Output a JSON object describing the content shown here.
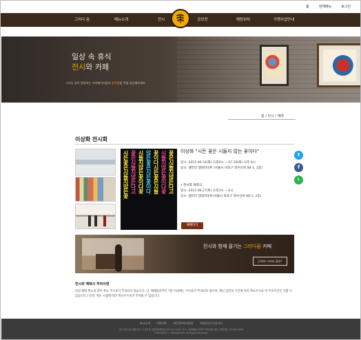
{
  "util": {
    "home": "홈",
    "login": "전체메뉴",
    "join": "로그인"
  },
  "nav": {
    "items": [
      "그리다 꿈",
      "메뉴소개",
      "전시",
      "공모전",
      "매장위치",
      "가맹사업안내"
    ]
  },
  "logo": {
    "name": "griddaggum-logo-icon",
    "color": "#f2a900"
  },
  "hero": {
    "line1": "일상 속 휴식",
    "line2_highlight": "전시",
    "line2_rest": "와 카페",
    "subtitle_prefix": "그리다 꿈이 응원하는 크리에이터들의 ",
    "subtitle_highlight": "창작품",
    "subtitle_suffix": "을 직접 감상해보세요"
  },
  "breadcrumb": "홈  /  전시  /  예매",
  "page_title": "이상화 전시회",
  "exhibit": {
    "title": "이상화 \"시든 꽃은 시들지 않는 꽃이다\"",
    "period": "일시: 2015.06.16(화) 오후6시 ~ 07.28(화) 오후 6시",
    "place": "장소: 갤러리 행원러미트 (서울시 마포구 와우산로 88-1, 2층)",
    "opening_label": "• 전시회 개최식",
    "opening_date": "일시: 2015.06.27(토) 오후3시 ~ 6시",
    "opening_place": "장소: 갤러리 행원러미트(서울시 마포구 와우산로 88-1, 2층)",
    "reserve_button": "예매하기"
  },
  "social": [
    {
      "name": "twitter-icon",
      "glyph": "t",
      "color": "#1da1f2"
    },
    {
      "name": "facebook-icon",
      "glyph": "f",
      "color": "#3b5998"
    },
    {
      "name": "line-icon",
      "glyph": "L",
      "color": "#2bb24c"
    }
  ],
  "cafe": {
    "text_prefix": "전시와 함께 즐기는 ",
    "text_highlight": "그리다꿈",
    "text_suffix": " 카페",
    "button": "근처의 그리다 꿈은?"
  },
  "notice": {
    "heading": "전시회 예매시 주의사항",
    "body": "당일 예매 취소의 경우 취소 수수료가 부과되지 않습니다. 단, 예매일로부터 7일 이내에는 수수료가 부과되지 않으며, 해당 공연의 기간에 따라 취소수수료 이 부과기간은 다를 수 있습니다.) 또한, 취소 시점에 따라 취소수수료가 부과될 수 있습니다."
  },
  "footer": {
    "links": [
      "회사소개",
      "이용약관",
      "개인정보처리방침",
      "이메일무단수집거부"
    ],
    "info1": "(주)그리다 꿈  대표이사: 이 아무개  사업자등록번호 000-00-00000  주소: 서울특별시 마포구 와우산로 88-1  대표번호: 02-000-0000",
    "info2": "COPYRIGHT ⓒ GRIDAGGUM. All Rights Reserved."
  }
}
